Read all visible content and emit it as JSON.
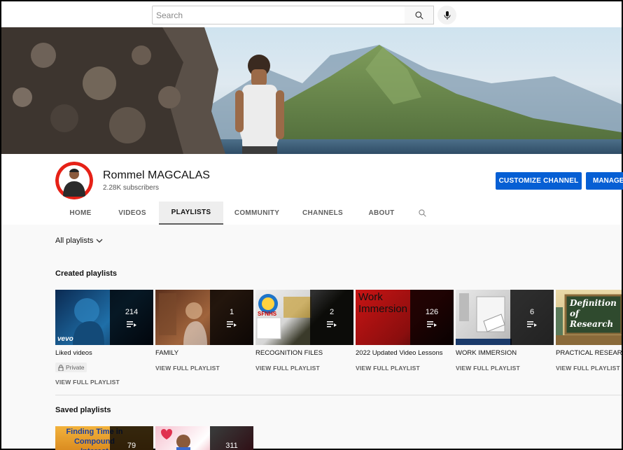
{
  "search": {
    "placeholder": "Search"
  },
  "channel": {
    "name": "Rommel MAGCALAS",
    "subscribers": "2.28K subscribers",
    "customize_label": "CUSTOMIZE CHANNEL",
    "manage_label": "MANAGE"
  },
  "tabs": [
    {
      "label": "HOME"
    },
    {
      "label": "VIDEOS"
    },
    {
      "label": "PLAYLISTS",
      "selected": true
    },
    {
      "label": "COMMUNITY"
    },
    {
      "label": "CHANNELS"
    },
    {
      "label": "ABOUT"
    }
  ],
  "sort": {
    "label": "All playlists"
  },
  "sections": {
    "created": "Created playlists",
    "saved": "Saved playlists"
  },
  "created": [
    {
      "title": "Liked videos",
      "count": "214",
      "badge": "Private",
      "link": "VIEW FULL PLAYLIST",
      "thumb_text": "vevo"
    },
    {
      "title": "FAMILY",
      "count": "1",
      "link": "VIEW FULL PLAYLIST",
      "thumb_text": ""
    },
    {
      "title": "RECOGNITION FILES",
      "count": "2",
      "link": "VIEW FULL PLAYLIST",
      "thumb_text": "SFNHS"
    },
    {
      "title": "2022 Updated Video Lessons",
      "count": "126",
      "link": "VIEW FULL PLAYLIST",
      "thumb_text": "Work Immersion"
    },
    {
      "title": "WORK IMMERSION",
      "count": "6",
      "link": "VIEW FULL PLAYLIST",
      "thumb_text": ""
    },
    {
      "title": "PRACTICAL RESEARCH",
      "count": "",
      "link": "VIEW FULL PLAYLIST",
      "thumb_text": "Definition of Research"
    }
  ],
  "saved": [
    {
      "count": "79",
      "thumb_text": "Finding Time in Compound Interest"
    },
    {
      "count": "311",
      "thumb_text": ""
    }
  ],
  "colors": {
    "accent": "#065fd4",
    "background": "#f9f9f9"
  }
}
